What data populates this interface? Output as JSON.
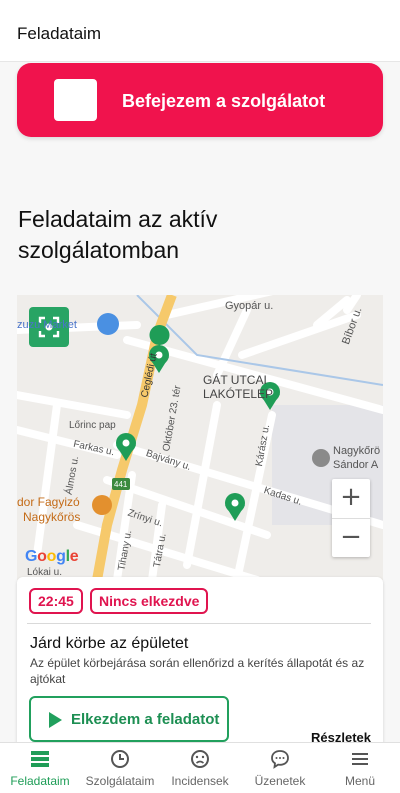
{
  "header": {
    "title": "Feladataim"
  },
  "finish_button": {
    "label": "Befejezem a szolgálatot"
  },
  "section": {
    "title": "Feladataim az aktív szolgálatomban"
  },
  "map": {
    "scan_icon": "qr-scan-icon",
    "labels": {
      "market": "zuzu Market",
      "gyopar": "Gyopár u.",
      "bibor": "Bíbor u.",
      "gat_line1": "GÁT UTCAI",
      "gat_line2": "LAKÓTELEP",
      "nagykoros_line1": "Nagykőrö",
      "nagykoros_line2": "Sándor A",
      "ceglédi": "Ceglédi út",
      "oktober": "Október 23. tér",
      "lorinc": "Lőrinc pap",
      "farkas": "Farkas u.",
      "bajvany": "Bajvány u.",
      "almos": "Álmos u.",
      "karasz": "Kárász u.",
      "kadas": "Kadas u.",
      "zrinyi": "Zrínyi u.",
      "tihany": "Tihany u.",
      "tatra": "Tátra u.",
      "fagyizo_line1": "dor Fagyizó",
      "fagyizo_line2": "Nagykőrös",
      "lokai": "Lókai u.",
      "road_441": "441"
    },
    "zoom_in": "+",
    "zoom_out": "−",
    "attribution": "Google"
  },
  "task": {
    "time": "22:45",
    "status": "Nincs elkezdve",
    "title": "Járd körbe az épületet",
    "description": "Az épület körbejárása során ellenőrizd a kerítés állapotát és az ajtókat",
    "start_label": "Elkezdem a feladatot",
    "details_label": "Részletek"
  },
  "bottom_nav": [
    {
      "label": "Feladataim",
      "icon": "tasks-icon",
      "active": true
    },
    {
      "label": "Szolgálataim",
      "icon": "clock-icon",
      "active": false
    },
    {
      "label": "Incidensek",
      "icon": "sad-face-icon",
      "active": false
    },
    {
      "label": "Üzenetek",
      "icon": "chat-icon",
      "active": false
    },
    {
      "label": "Menü",
      "icon": "menu-icon",
      "active": false
    }
  ],
  "colors": {
    "accent_red": "#f0134d",
    "accent_green": "#21a05d"
  }
}
